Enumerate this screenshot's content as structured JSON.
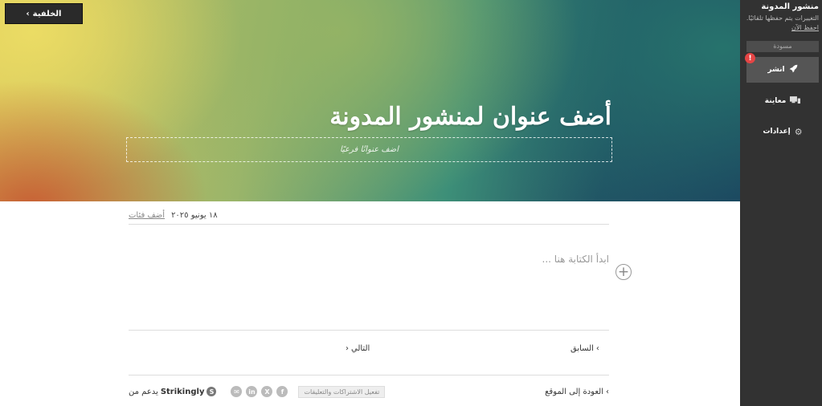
{
  "toolbar": {
    "back_label": "الخلفية"
  },
  "post": {
    "title": "أضف عنوان لمنشور المدونة",
    "subtitle_placeholder": "أضف عنوانًا فرعيًا",
    "date": "١٨ يونيو ٢٠٢٥",
    "add_category": "أضف فئات",
    "body_placeholder": "ابدأ الكتابة هنا ...",
    "prev_label": "السابق",
    "next_label": "التالي"
  },
  "footer": {
    "back_to_site": "العودة إلى الموقع",
    "enable_label": "تفعيل الاشتراكات والتعليقات",
    "powered_prefix": "يدعم من",
    "brand": "Strikingly",
    "logo_letter": "S"
  },
  "share_icons": [
    "facebook-icon",
    "x-icon",
    "linkedin-icon",
    "email-icon"
  ],
  "share_glyphs": {
    "facebook": "f",
    "x": "X",
    "linkedin": "in",
    "email": "✉"
  },
  "sidebar": {
    "title": "منشور المدونة",
    "status": "التغييرات يتم حفظها تلقائيًا.",
    "save_now": "احفظ الآن",
    "draft_label": "مسودة",
    "publish_label": "انشر",
    "alert": "!",
    "preview_label": "معاينة",
    "settings_label": "إعدادات"
  },
  "colors": {
    "sidebar_bg": "#323232",
    "alert": "#e54545"
  }
}
